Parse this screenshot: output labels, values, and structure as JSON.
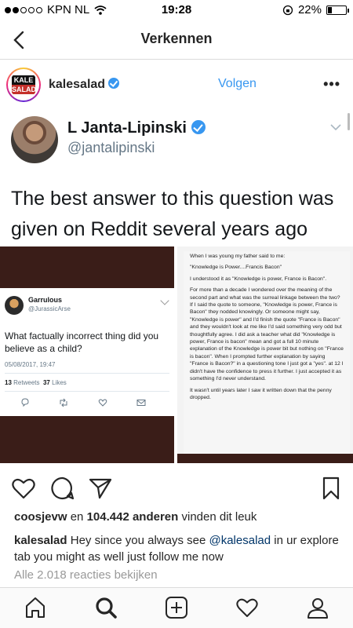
{
  "status_bar": {
    "carrier": "KPN NL",
    "time": "19:28",
    "battery_text": "22%",
    "battery_level": 0.22
  },
  "nav": {
    "title": "Verkennen",
    "back_icon": "chevron-left-icon"
  },
  "post": {
    "username": "kalesalad",
    "avatar_text_top": "KALE",
    "avatar_text_bottom": "SALAD",
    "follow_label": "Volgen",
    "more_label": "•••"
  },
  "image": {
    "tweet": {
      "name": "L Janta-Lipinski",
      "handle": "@jantalipinski",
      "text": "The best answer to this question was given on Reddit several years ago"
    },
    "inner_tweet": {
      "name": "Garrulous",
      "handle": "@JurassicArse",
      "text": "What factually incorrect thing did you believe as a child?",
      "date": "05/08/2017, 19:47",
      "retweets_count": "13",
      "retweets_label": "Retweets",
      "likes_count": "37",
      "likes_label": "Likes"
    },
    "reddit_text": [
      "When I was young my father said to me:",
      "\"Knowledge is Power....Francis Bacon\"",
      "I understood it as \"Knowledge is power, France is Bacon\".",
      "For more than a decade I wondered over the meaning of the second part and what was the surreal linkage between the two? If I said the quote to someone, \"Knowledge is power, France is Bacon\" they nodded knowingly. Or someone might say, \"Knowledge is power\" and I'd finish the quote \"France is Bacon\" and they wouldn't look at me like I'd said something very odd but thoughtfully agree. I did ask a teacher what did \"Knowledge is power, France is bacon\" mean and got a full 10 minute explanation of the Knowledge is power bit but nothing on \"France is bacon\". When I prompted further explanation by saying \"France is Bacon?\" in a questioning tone I just got a \"yes\". at 12 I didn't have the confidence to press it further. I just accepted it as something I'd never understand.",
      "It wasn't until years later I saw it written down that the penny dropped."
    ]
  },
  "actions": {
    "likes_user": "coosjevw",
    "likes_middle": " en ",
    "likes_count": "104.442 anderen",
    "likes_suffix": " vinden dit leuk",
    "caption_user": "kalesalad",
    "caption_pre": " Hey since you always see ",
    "caption_mention": "@kalesalad",
    "caption_post": " in ur explore tab you might as well just follow me now",
    "view_comments": "Alle 2.018 reacties bekijken"
  },
  "tabbar": {
    "items": [
      "home-icon",
      "search-icon",
      "add-icon",
      "heart-icon",
      "profile-icon"
    ]
  }
}
